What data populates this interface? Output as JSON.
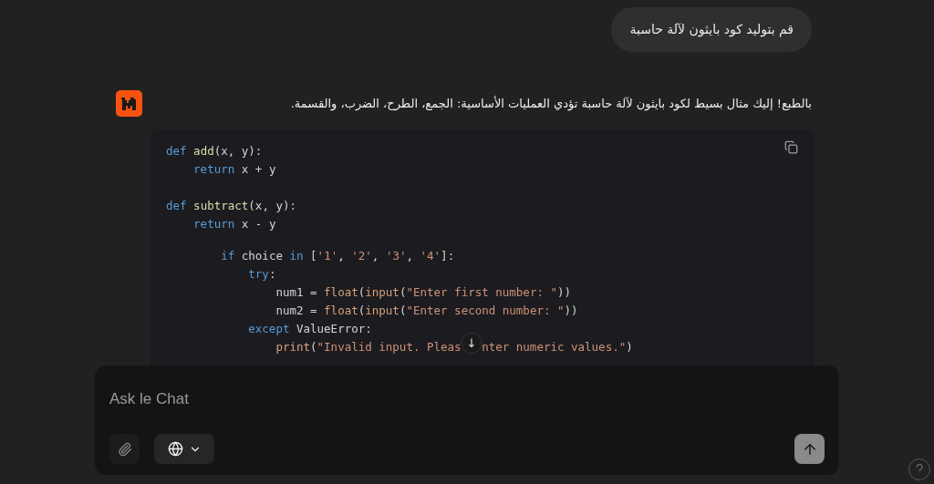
{
  "user_message": {
    "text": "قم بتوليد كود بايثون لآلة حاسبة"
  },
  "assistant_message": {
    "text": "بالطبع! إليك مثال بسيط لكود بايثون لآلة حاسبة تؤدي العمليات الأساسية: الجمع، الطرح، الضرب، والقسمة.",
    "code_blocks": [
      {
        "indented": false,
        "lines": [
          {
            "tokens": [
              {
                "kind": "keyword",
                "text": "def "
              },
              {
                "kind": "function",
                "text": "add"
              },
              {
                "kind": "plain",
                "text": "(x, y):"
              }
            ],
            "children": [
              {
                "tokens": [
                  {
                    "kind": "keyword",
                    "text": "return"
                  },
                  {
                    "kind": "plain",
                    "text": " x + y"
                  }
                ]
              }
            ]
          }
        ]
      },
      {
        "indented": false,
        "lines": [
          {
            "tokens": [
              {
                "kind": "keyword",
                "text": "def "
              },
              {
                "kind": "function",
                "text": "subtract"
              },
              {
                "kind": "plain",
                "text": "(x, y):"
              }
            ],
            "children": [
              {
                "tokens": [
                  {
                    "kind": "keyword",
                    "text": "return"
                  },
                  {
                    "kind": "plain",
                    "text": " x - y"
                  }
                ]
              }
            ]
          }
        ]
      },
      {
        "indented": true,
        "lines": [
          {
            "tokens": [
              {
                "kind": "keyword",
                "text": "if"
              },
              {
                "kind": "plain",
                "text": " choice "
              },
              {
                "kind": "keyword",
                "text": "in"
              },
              {
                "kind": "plain",
                "text": " ["
              },
              {
                "kind": "string",
                "text": "'1'"
              },
              {
                "kind": "plain",
                "text": ", "
              },
              {
                "kind": "string",
                "text": "'2'"
              },
              {
                "kind": "plain",
                "text": ", "
              },
              {
                "kind": "string",
                "text": "'3'"
              },
              {
                "kind": "plain",
                "text": ", "
              },
              {
                "kind": "string",
                "text": "'4'"
              },
              {
                "kind": "plain",
                "text": "]:"
              }
            ],
            "children": [
              {
                "tokens": [
                  {
                    "kind": "keyword",
                    "text": "try"
                  },
                  {
                    "kind": "plain",
                    "text": ":"
                  }
                ],
                "children": [
                  {
                    "tokens": [
                      {
                        "kind": "plain",
                        "text": "num1 = "
                      },
                      {
                        "kind": "builtin",
                        "text": "float"
                      },
                      {
                        "kind": "plain",
                        "text": "("
                      },
                      {
                        "kind": "builtin",
                        "text": "input"
                      },
                      {
                        "kind": "plain",
                        "text": "("
                      },
                      {
                        "kind": "string",
                        "text": "\"Enter first number: \""
                      },
                      {
                        "kind": "plain",
                        "text": "))"
                      }
                    ]
                  },
                  {
                    "tokens": [
                      {
                        "kind": "plain",
                        "text": "num2 = "
                      },
                      {
                        "kind": "builtin",
                        "text": "float"
                      },
                      {
                        "kind": "plain",
                        "text": "("
                      },
                      {
                        "kind": "builtin",
                        "text": "input"
                      },
                      {
                        "kind": "plain",
                        "text": "("
                      },
                      {
                        "kind": "string",
                        "text": "\"Enter second number: \""
                      },
                      {
                        "kind": "plain",
                        "text": "))"
                      }
                    ]
                  }
                ]
              },
              {
                "tokens": [
                  {
                    "kind": "keyword",
                    "text": "except"
                  },
                  {
                    "kind": "plain",
                    "text": " ValueError:"
                  }
                ],
                "children": [
                  {
                    "tokens": [
                      {
                        "kind": "builtin",
                        "text": "print"
                      },
                      {
                        "kind": "plain",
                        "text": "("
                      },
                      {
                        "kind": "string",
                        "text": "\"Invalid input. Pleas"
                      },
                      {
                        "kind": "gap",
                        "text": "↓"
                      },
                      {
                        "kind": "string",
                        "text": "nter numeric values.\""
                      },
                      {
                        "kind": "plain",
                        "text": ")"
                      }
                    ]
                  }
                ]
              }
            ]
          }
        ]
      }
    ]
  },
  "composer": {
    "placeholder": "Ask le Chat"
  }
}
